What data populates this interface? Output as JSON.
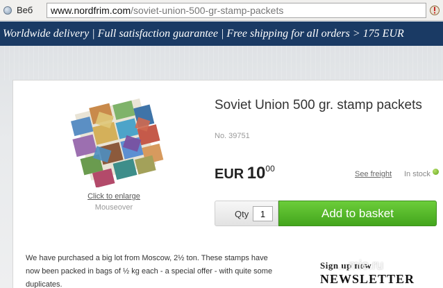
{
  "browser": {
    "web_label": "Веб",
    "url_domain": "www.nordfrim.com",
    "url_path": "/soviet-union-500-gr-stamp-packets"
  },
  "promo": {
    "text": "Worldwide delivery | Full satisfaction guarantee | Free shipping for all orders > 175 EUR"
  },
  "product": {
    "title": "Soviet Union 500 gr. stamp packets",
    "number": "No. 39751",
    "enlarge_link": "Click to enlarge",
    "mouseover_hint": "Mouseover",
    "price_currency": "EUR",
    "price_integer": "10",
    "price_decimal": "00",
    "freight_link": "See freight",
    "stock_status": "In stock",
    "stock_color": "#63a51a",
    "qty_label": "Qty",
    "qty_value": "1",
    "add_button": "Add to basket",
    "description": "We have purchased a big lot from Moscow, 2½ ton. These stamps have now been packed in bags of ½ kg each - a special offer - with quite some duplicates."
  },
  "newsletter": {
    "signup": "Sign up now",
    "title": "NEWSLETTER"
  },
  "watermark": "...mie.ru",
  "colors": {
    "banner": "#1a3a64",
    "button_green": "#4caf26"
  }
}
